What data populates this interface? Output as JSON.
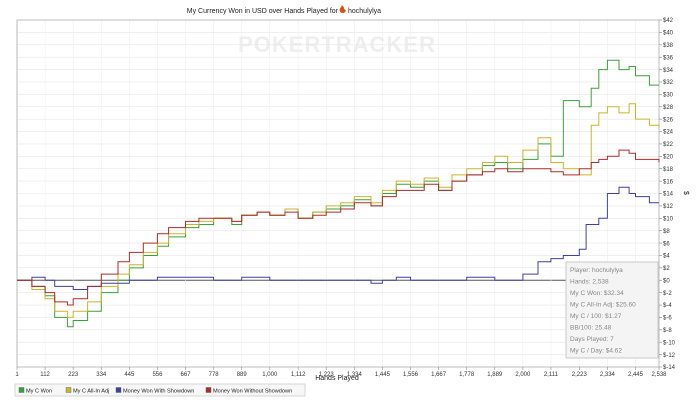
{
  "title_prefix": "My Currency Won in USD over Hands Played for",
  "title_player": "hochulylya",
  "watermark": "POKERTRACKER",
  "chart_data": {
    "type": "line",
    "title": "My Currency Won in USD over Hands Played for hochulylya",
    "xlabel": "Hands Played",
    "ylabel": "$",
    "xlim": [
      1,
      2538
    ],
    "ylim": [
      -14,
      42
    ],
    "x_ticks": [
      1,
      112,
      223,
      334,
      445,
      556,
      667,
      778,
      889,
      1000,
      1112,
      1223,
      1334,
      1445,
      1556,
      1667,
      1778,
      1889,
      2000,
      2111,
      2223,
      2334,
      2445,
      2538
    ],
    "x_tick_labels": [
      "1",
      "112",
      "223",
      "334",
      "445",
      "556",
      "667",
      "778",
      "889",
      "1,000",
      "1,112",
      "1,223",
      "1,334",
      "1,445",
      "1,556",
      "1,667",
      "1,778",
      "1,889",
      "2,000",
      "2,111",
      "2,223",
      "2,334",
      "2,445",
      "2,538"
    ],
    "y_ticks": [
      -14,
      -12,
      -10,
      -8,
      -6,
      -4,
      -2,
      0,
      2,
      4,
      6,
      8,
      10,
      12,
      14,
      16,
      18,
      20,
      22,
      24,
      26,
      28,
      30,
      32,
      34,
      36,
      38,
      40,
      42
    ],
    "y_tick_labels": [
      "$-14",
      "$-12",
      "$-10",
      "$-8",
      "$-6",
      "$-4",
      "$-2",
      "$0",
      "$2",
      "$4",
      "$6",
      "$8",
      "$10",
      "$12",
      "$14",
      "$16",
      "$18",
      "$20",
      "$22",
      "$24",
      "$26",
      "$28",
      "$30",
      "$32",
      "$34",
      "$36",
      "$38",
      "$40",
      "$42"
    ],
    "grid": true,
    "legend_position": "bottom",
    "series": [
      {
        "name": "My C Won",
        "color": "#3aa038",
        "points": [
          [
            1,
            0
          ],
          [
            60,
            -1
          ],
          [
            112,
            -2.5
          ],
          [
            150,
            -6
          ],
          [
            200,
            -7.5
          ],
          [
            223,
            -6.5
          ],
          [
            280,
            -5
          ],
          [
            334,
            -2
          ],
          [
            400,
            0
          ],
          [
            445,
            2
          ],
          [
            500,
            4
          ],
          [
            556,
            5.5
          ],
          [
            600,
            7
          ],
          [
            667,
            8.5
          ],
          [
            720,
            9
          ],
          [
            778,
            10
          ],
          [
            850,
            9
          ],
          [
            889,
            10.5
          ],
          [
            950,
            11
          ],
          [
            1000,
            10.5
          ],
          [
            1060,
            11.5
          ],
          [
            1112,
            10
          ],
          [
            1170,
            11
          ],
          [
            1223,
            11.5
          ],
          [
            1280,
            12
          ],
          [
            1334,
            13
          ],
          [
            1400,
            12
          ],
          [
            1445,
            14
          ],
          [
            1500,
            15.5
          ],
          [
            1556,
            15
          ],
          [
            1610,
            16
          ],
          [
            1667,
            14.5
          ],
          [
            1720,
            16
          ],
          [
            1778,
            17
          ],
          [
            1840,
            18.5
          ],
          [
            1889,
            19
          ],
          [
            1940,
            18
          ],
          [
            2000,
            19.5
          ],
          [
            2060,
            22
          ],
          [
            2111,
            20
          ],
          [
            2160,
            29
          ],
          [
            2223,
            28
          ],
          [
            2270,
            31
          ],
          [
            2300,
            34
          ],
          [
            2334,
            35.5
          ],
          [
            2380,
            34
          ],
          [
            2420,
            34.5
          ],
          [
            2445,
            33
          ],
          [
            2500,
            31.5
          ],
          [
            2538,
            31.5
          ]
        ]
      },
      {
        "name": "My C All-In Adj",
        "color": "#c9b52c",
        "points": [
          [
            1,
            0
          ],
          [
            60,
            -1.5
          ],
          [
            112,
            -3
          ],
          [
            150,
            -5
          ],
          [
            200,
            -6
          ],
          [
            223,
            -5
          ],
          [
            280,
            -3.5
          ],
          [
            334,
            -1
          ],
          [
            400,
            1
          ],
          [
            445,
            2.5
          ],
          [
            500,
            4.5
          ],
          [
            556,
            6
          ],
          [
            600,
            7.5
          ],
          [
            667,
            9
          ],
          [
            720,
            9.5
          ],
          [
            778,
            10
          ],
          [
            850,
            9.5
          ],
          [
            889,
            10.5
          ],
          [
            950,
            11
          ],
          [
            1000,
            10.5
          ],
          [
            1060,
            11.5
          ],
          [
            1112,
            10
          ],
          [
            1170,
            11
          ],
          [
            1223,
            12
          ],
          [
            1280,
            12.5
          ],
          [
            1334,
            13.5
          ],
          [
            1400,
            12.5
          ],
          [
            1445,
            14.5
          ],
          [
            1500,
            16
          ],
          [
            1556,
            15.5
          ],
          [
            1610,
            16.5
          ],
          [
            1667,
            15
          ],
          [
            1720,
            17
          ],
          [
            1778,
            18
          ],
          [
            1840,
            19
          ],
          [
            1889,
            20
          ],
          [
            1940,
            19
          ],
          [
            2000,
            21
          ],
          [
            2060,
            23
          ],
          [
            2111,
            19
          ],
          [
            2160,
            18
          ],
          [
            2223,
            17
          ],
          [
            2270,
            25
          ],
          [
            2300,
            27
          ],
          [
            2334,
            28
          ],
          [
            2380,
            27
          ],
          [
            2420,
            28.5
          ],
          [
            2445,
            26
          ],
          [
            2500,
            25
          ],
          [
            2538,
            24.5
          ]
        ]
      },
      {
        "name": "Money Won With Showdown",
        "color": "#3f3fa8",
        "points": [
          [
            1,
            0
          ],
          [
            60,
            0.5
          ],
          [
            112,
            0
          ],
          [
            150,
            -1
          ],
          [
            223,
            -1.5
          ],
          [
            280,
            -1
          ],
          [
            334,
            -0.5
          ],
          [
            445,
            0
          ],
          [
            556,
            0.5
          ],
          [
            667,
            0.5
          ],
          [
            778,
            0
          ],
          [
            889,
            0.5
          ],
          [
            1000,
            0
          ],
          [
            1112,
            0
          ],
          [
            1223,
            0
          ],
          [
            1334,
            0
          ],
          [
            1400,
            -0.5
          ],
          [
            1445,
            0
          ],
          [
            1500,
            0.5
          ],
          [
            1556,
            0
          ],
          [
            1667,
            0
          ],
          [
            1778,
            0.5
          ],
          [
            1889,
            0
          ],
          [
            2000,
            1
          ],
          [
            2060,
            3
          ],
          [
            2111,
            3.5
          ],
          [
            2160,
            4
          ],
          [
            2223,
            5
          ],
          [
            2250,
            9
          ],
          [
            2300,
            10
          ],
          [
            2334,
            14
          ],
          [
            2380,
            15
          ],
          [
            2420,
            14
          ],
          [
            2445,
            13.5
          ],
          [
            2500,
            12.5
          ],
          [
            2538,
            12.5
          ]
        ]
      },
      {
        "name": "Money Won Without Showdown",
        "color": "#b02a2a",
        "points": [
          [
            1,
            0
          ],
          [
            60,
            -1
          ],
          [
            112,
            -2
          ],
          [
            150,
            -3.5
          ],
          [
            200,
            -4
          ],
          [
            223,
            -3
          ],
          [
            280,
            -1
          ],
          [
            334,
            1
          ],
          [
            400,
            3
          ],
          [
            445,
            4.5
          ],
          [
            500,
            6
          ],
          [
            556,
            7.5
          ],
          [
            600,
            8.5
          ],
          [
            667,
            9.5
          ],
          [
            720,
            10
          ],
          [
            778,
            10
          ],
          [
            850,
            9.5
          ],
          [
            889,
            10.5
          ],
          [
            950,
            11
          ],
          [
            1000,
            10.5
          ],
          [
            1060,
            11
          ],
          [
            1112,
            10
          ],
          [
            1170,
            10.5
          ],
          [
            1223,
            11
          ],
          [
            1280,
            11.5
          ],
          [
            1334,
            12.5
          ],
          [
            1400,
            12
          ],
          [
            1445,
            13.5
          ],
          [
            1500,
            14.5
          ],
          [
            1556,
            14.5
          ],
          [
            1610,
            15.5
          ],
          [
            1667,
            14.5
          ],
          [
            1720,
            16
          ],
          [
            1778,
            17
          ],
          [
            1840,
            17.5
          ],
          [
            1889,
            18
          ],
          [
            1940,
            17.5
          ],
          [
            2000,
            18
          ],
          [
            2060,
            18
          ],
          [
            2111,
            17.5
          ],
          [
            2160,
            17
          ],
          [
            2223,
            18
          ],
          [
            2270,
            19
          ],
          [
            2300,
            19.5
          ],
          [
            2334,
            20
          ],
          [
            2380,
            21
          ],
          [
            2420,
            20.5
          ],
          [
            2445,
            19.5
          ],
          [
            2500,
            19.5
          ],
          [
            2538,
            19
          ]
        ]
      }
    ]
  },
  "stats_box": [
    "Player: hochulylya",
    "Hands: 2,538",
    "My C Won: $32.34",
    "My C All-In Adj: $25.60",
    "My C / 100: $1.27",
    "BB/100: 25.48",
    "Days Played: 7",
    "My C / Day: $4.62"
  ]
}
